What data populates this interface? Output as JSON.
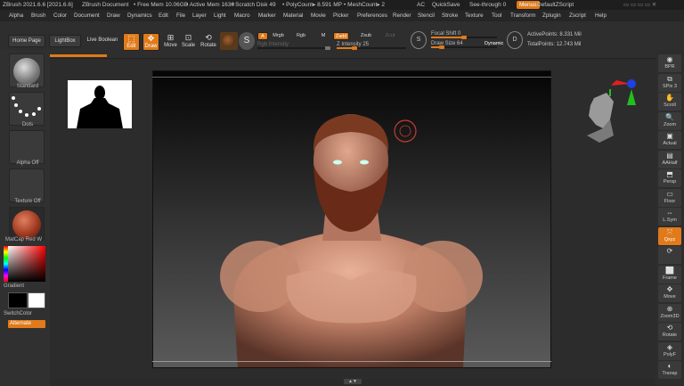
{
  "titlebar": {
    "app": "ZBrush 2021.6.6 [2021.6.6]",
    "doc": "ZBrush Document",
    "free_mem": "• Free Mem 10.06GB",
    "active_mem": "• Active Mem 1630",
    "scratch": "• Scratch Disk 49",
    "polycount": "• PolyCount▸ 8.591 MP",
    "meshcount": "• MeshCount▸ 2",
    "ac": "AC",
    "quicksave": "QuickSave",
    "seethrough": "See-through  0",
    "menus": "Menus",
    "script": "DefaultZScript"
  },
  "menubar": [
    "Alpha",
    "Brush",
    "Color",
    "Document",
    "Draw",
    "Dynamics",
    "Edit",
    "File",
    "Layer",
    "Light",
    "Macro",
    "Marker",
    "Material",
    "Movie",
    "Picker",
    "Preferences",
    "Render",
    "Stencil",
    "Stroke",
    "Texture",
    "Tool",
    "Transform",
    "Zplugin",
    "Zscript",
    "Help"
  ],
  "toolbar": {
    "home": "Home Page",
    "lightbox": "LightBox",
    "live_boolean": "Live Boolean",
    "edit": "Edit",
    "draw": "Draw",
    "move": "Move",
    "scale": "Scale",
    "rotate": "Rotate",
    "a": "A",
    "mrgb": "Mrgb",
    "rgb": "Rgb",
    "m": "M",
    "zadd": "Zadd",
    "zsub": "Zsub",
    "zcut": "Zcut",
    "rgb_intensity": "Rgb Intensity",
    "z_intensity": "Z Intensity 25",
    "focal_shift": "Focal Shift 0",
    "draw_size": "Draw Size 64",
    "dynamic": "Dynamic",
    "active_points": "ActivePoints: 8.331 Mil",
    "total_points": "TotalPoints: 12.743 Mil"
  },
  "slider_levels": {
    "z_intensity": 0.25,
    "focal_shift": 0.5,
    "draw_size": 0.16
  },
  "leftshelf": {
    "standard": "Standard",
    "dots": "Dots",
    "alpha": "Alpha Off",
    "texture": "Texture Off",
    "matcap": "MatCap Red W",
    "gradient": "Gradient",
    "switchcolor": "SwitchColor",
    "alternate": "Alternate"
  },
  "rightshelf": [
    "BPR",
    "SPix 3",
    "Scroll",
    "Zoom",
    "Actual",
    "AAHalf",
    "Persp",
    "Floor",
    "L.Sym",
    "Qxyz",
    "",
    "Frame",
    "Move",
    "Zoom3D",
    "Rotate",
    "PolyF",
    "Transp"
  ],
  "colors": {
    "accent": "#e07a1a",
    "bg": "#333333",
    "canvas_top": "#050505",
    "canvas_bottom": "#5a5a5a"
  }
}
